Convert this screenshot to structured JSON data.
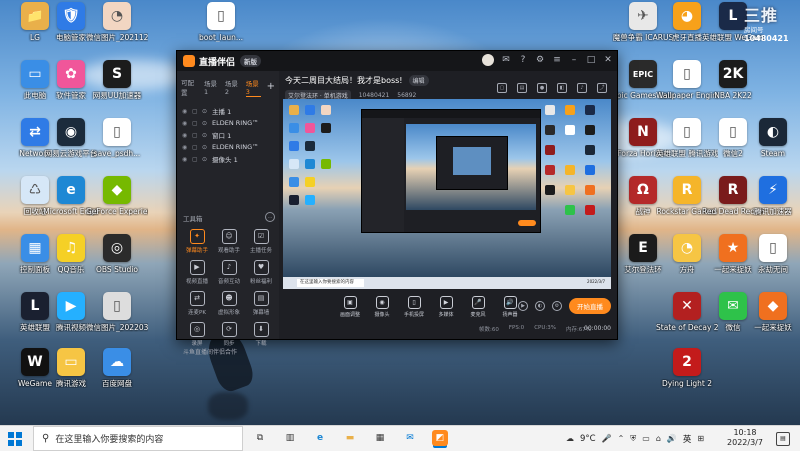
{
  "desktop": {
    "icons_left": [
      {
        "label": "LG",
        "color": "#e9b04a",
        "glyph": "📁"
      },
      {
        "label": "电脑管家",
        "color": "#2f7be6",
        "glyph": "🛡"
      },
      {
        "label": "微信图片_2021122...",
        "color": "#f2d6c2",
        "glyph": "◔"
      },
      {
        "label": "boot_laun...",
        "color": "#ffffff",
        "glyph": "▯"
      },
      {
        "label": "此电脑",
        "color": "#3a8ee6",
        "glyph": "▭"
      },
      {
        "label": "软件管家",
        "color": "#f0569a",
        "glyph": "✿"
      },
      {
        "label": "网易UU加速器",
        "color": "#1c1c1c",
        "glyph": "S"
      },
      {
        "label": "Network",
        "color": "#2f7be6",
        "glyph": "⇄"
      },
      {
        "label": "网易云游戏平台",
        "color": "#1b2b3c",
        "glyph": "◉"
      },
      {
        "label": "save_psdh...",
        "color": "#ffffff",
        "glyph": "▯"
      },
      {
        "label": "回收站",
        "color": "#d6e7f7",
        "glyph": "♺"
      },
      {
        "label": "Microsoft Edge",
        "color": "#1e88d4",
        "glyph": "e"
      },
      {
        "label": "GeForce Experience",
        "color": "#76b900",
        "glyph": "◆"
      },
      {
        "label": "控制面板",
        "color": "#3a8ee6",
        "glyph": "▦"
      },
      {
        "label": "QQ音乐",
        "color": "#f5d026",
        "glyph": "♫"
      },
      {
        "label": "OBS Studio",
        "color": "#2b2b2b",
        "glyph": "◎"
      },
      {
        "label": "英雄联盟",
        "color": "#1a2030",
        "glyph": "L"
      },
      {
        "label": "腾讯视频",
        "color": "#25b0ff",
        "glyph": "▶"
      },
      {
        "label": "微信图片_2022030...",
        "color": "#dddddd",
        "glyph": "▯"
      },
      {
        "label": "WeGame",
        "color": "#111111",
        "glyph": "W"
      },
      {
        "label": "腾讯游戏",
        "color": "#f6c544",
        "glyph": "▭"
      },
      {
        "label": "百度网盘",
        "color": "#3a8ee6",
        "glyph": "☁"
      }
    ],
    "icons_right": [
      {
        "label": "魔兽争霸 ICARUS",
        "color": "#e8e8e8",
        "glyph": "✈"
      },
      {
        "label": "虎牙直播",
        "color": "#f7a11a",
        "glyph": "◕"
      },
      {
        "label": "英雄联盟 WeGame版",
        "color": "#1a2a48",
        "glyph": "L"
      },
      {
        "label": "Epic Games Launcher",
        "color": "#2a2a2a",
        "glyph": "EPIC"
      },
      {
        "label": "Wallpaper Engine",
        "color": "#ffffff",
        "glyph": "▯"
      },
      {
        "label": "NBA 2K22",
        "color": "#1c1c1c",
        "glyph": "2K"
      },
      {
        "label": "Forza Horizon",
        "color": "#8f1d1d",
        "glyph": "N"
      },
      {
        "label": "英雄联盟 腾讯游戏",
        "color": "#ffffff",
        "glyph": "▯"
      },
      {
        "label": "微信2",
        "color": "#ffffff",
        "glyph": "▯"
      },
      {
        "label": "Steam",
        "color": "#1b2838",
        "glyph": "◐"
      },
      {
        "label": "战神",
        "color": "#b52a2a",
        "glyph": "Ω"
      },
      {
        "label": "Rockstar Games",
        "color": "#f5b52a",
        "glyph": "R"
      },
      {
        "label": "Red Dead Redemption",
        "color": "#7a1b1b",
        "glyph": "R"
      },
      {
        "label": "腾讯加速器",
        "color": "#1f6fe0",
        "glyph": "⚡"
      },
      {
        "label": "艾尔登法环",
        "color": "#1c1c1c",
        "glyph": "E"
      },
      {
        "label": "方舟",
        "color": "#f6c544",
        "glyph": "◔"
      },
      {
        "label": "一起来捉妖",
        "color": "#f0701f",
        "glyph": "★"
      },
      {
        "label": "永劫无间",
        "color": "#ffffff",
        "glyph": "▯"
      },
      {
        "label": "State of Decay 2",
        "color": "#b32020",
        "glyph": "✕"
      },
      {
        "label": "微信",
        "color": "#2ec24a",
        "glyph": "✉"
      },
      {
        "label": "一起来捉妖",
        "color": "#f0701f",
        "glyph": "◆"
      },
      {
        "label": "Dying Light 2",
        "color": "#c31b1b",
        "glyph": "2"
      }
    ]
  },
  "widget": {
    "line1": "三推",
    "line2": "房间号",
    "line3": "10480421"
  },
  "app": {
    "brand": "直播伴侣",
    "version": "新版",
    "tabs": [
      "可配置",
      "场景1",
      "场景2",
      "场景3"
    ],
    "active_tab": "场景3",
    "scenes": [
      {
        "label": "主播 1"
      },
      {
        "label": "ELDEN RING™"
      },
      {
        "label": "窗口 1"
      },
      {
        "label": "ELDEN RING™"
      },
      {
        "label": "摄像头 1"
      }
    ],
    "tools_header": "工具箱",
    "tools": [
      {
        "label": "弹幕助手",
        "glyph": "✦",
        "hot": true
      },
      {
        "label": "观看助手",
        "glyph": "☺",
        "hot": false
      },
      {
        "label": "主播任务",
        "glyph": "☑",
        "hot": false
      },
      {
        "label": "视频直播",
        "glyph": "▶",
        "hot": false
      },
      {
        "label": "音频互动",
        "glyph": "♪",
        "hot": false
      },
      {
        "label": "粉丝福利",
        "glyph": "♥",
        "hot": false
      },
      {
        "label": "连麦PK",
        "glyph": "⇄",
        "hot": false
      },
      {
        "label": "虚拟形象",
        "glyph": "☻",
        "hot": false
      },
      {
        "label": "弹幕墙",
        "glyph": "▤",
        "hot": false
      },
      {
        "label": "录屏",
        "glyph": "◎",
        "hot": false
      },
      {
        "label": "同步",
        "glyph": "⟳",
        "hot": false
      },
      {
        "label": "下载",
        "glyph": "⬇",
        "hot": false
      }
    ],
    "left_bottom": "斗鱼直播间伴侣合作",
    "live_title": "今天二周目大结局！我才是boss!",
    "edit_label": "编辑",
    "meta_category": "艾尔登法环 · 单机游戏",
    "meta_room": "10480421",
    "meta_views": "56892",
    "actions": [
      {
        "label": "画面调整",
        "glyph": "▣"
      },
      {
        "label": "摄像头",
        "glyph": "◉"
      },
      {
        "label": "手机投屏",
        "glyph": "▯"
      },
      {
        "label": "多媒体",
        "glyph": "▶"
      },
      {
        "label": "麦克风",
        "glyph": "🎤"
      },
      {
        "label": "扬声器",
        "glyph": "🔊"
      }
    ],
    "start_live": "开始直播",
    "status": [
      "帧数:60",
      "FPS:0",
      "CPU:3%",
      "内存:67%"
    ],
    "timer": "00:00:00",
    "preview_search": "在这里输入你要搜索的内容",
    "preview_clock": "2022/3/7"
  },
  "taskbar": {
    "search_placeholder": "在这里输入你要搜索的内容",
    "weather": "9°C",
    "ime": "英",
    "time": "10:18",
    "date": "2022/3/7",
    "apps": [
      {
        "name": "task-view",
        "glyph": "⧉"
      },
      {
        "name": "file-manager",
        "glyph": "▥"
      },
      {
        "name": "edge",
        "glyph": "e"
      },
      {
        "name": "folder",
        "glyph": "▬"
      },
      {
        "name": "store",
        "glyph": "▦"
      },
      {
        "name": "mail",
        "glyph": "✉"
      },
      {
        "name": "live-app",
        "glyph": "◩"
      }
    ]
  }
}
